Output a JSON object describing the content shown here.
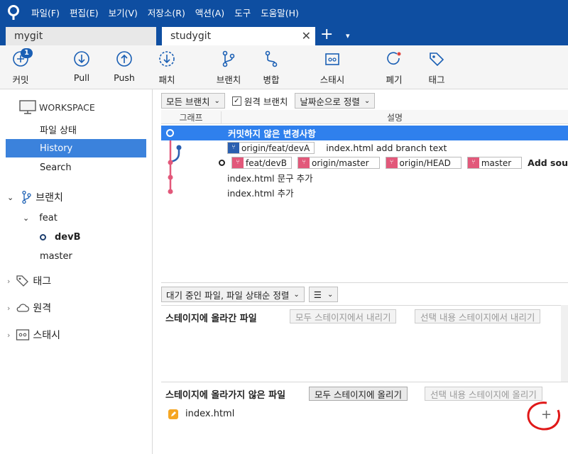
{
  "menu": [
    "파일(F)",
    "편집(E)",
    "보기(V)",
    "저장소(R)",
    "액션(A)",
    "도구",
    "도움말(H)"
  ],
  "tabs": [
    {
      "label": "mygit"
    },
    {
      "label": "studygit",
      "close": "✕"
    }
  ],
  "tabbar": {
    "plus": "+",
    "caret": "▾"
  },
  "toolbar": {
    "commit": "커밋",
    "commit_badge": "1",
    "pull": "Pull",
    "push": "Push",
    "fetch": "패치",
    "branch": "브랜치",
    "merge": "병합",
    "stash": "스태시",
    "discard": "폐기",
    "tag": "태그"
  },
  "sidebar": {
    "workspace": "WORKSPACE",
    "file_status": "파일 상태",
    "history": "History",
    "search": "Search",
    "branches": "브랜치",
    "feat": "feat",
    "devB": "devB",
    "master": "master",
    "tags": "태그",
    "remotes": "원격",
    "stashes": "스태시"
  },
  "filter": {
    "branch_select": "모든 브랜치",
    "remote_branches": "원격 브랜치",
    "sort_select": "날짜순으로 정렬"
  },
  "columns": {
    "graph": "그래프",
    "description": "설명"
  },
  "commits": {
    "uncommitted": "커밋하지 않은 변경사항",
    "c1_ref": "origin/feat/devA",
    "c1_msg": "index.html add branch text",
    "c2_refs": [
      "feat/devB",
      "origin/master",
      "origin/HEAD",
      "master"
    ],
    "c2_msg": "Add sou",
    "c3_msg": "index.html 문구 추가",
    "c4_msg": "index.html 추가"
  },
  "pending": {
    "sort_select": "대기 중인 파일, 파일 상태순 정렬",
    "view_select": "☰"
  },
  "staged": {
    "title": "스테이지에 올라간 파일",
    "unstage_all": "모두 스테이지에서 내리기",
    "unstage_selected": "선택 내용 스테이지에서 내리기"
  },
  "unstaged": {
    "title": "스테이지에 올라가지 않은 파일",
    "stage_all": "모두 스테이지에 올리기",
    "stage_selected": "선택 내용 스테이지에 올리기",
    "file": "index.html",
    "plus": "+"
  },
  "colors": {
    "brand": "#0e4ea1",
    "selection": "#2f80ed",
    "branch_pink": "#e2587a",
    "branch_blue": "#2a5fb0"
  }
}
